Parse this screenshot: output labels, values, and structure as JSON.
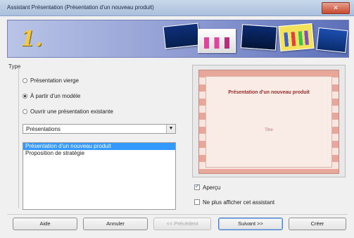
{
  "window": {
    "title": "Assistant Présentation (Présentation d'un nouveau produit)",
    "close_icon": "close-icon"
  },
  "banner": {
    "step_number": "1."
  },
  "type_section": {
    "label": "Type",
    "options": [
      {
        "label": "Présentation vierge",
        "checked": false
      },
      {
        "label": "À partir d'un modèle",
        "checked": true
      },
      {
        "label": "Ouvrir une présentation existante",
        "checked": false
      }
    ]
  },
  "template_category": {
    "selected": "Présentations",
    "arrow_icon": "chevron-down-icon"
  },
  "template_list": {
    "items": [
      {
        "label": "Présentation d'un nouveau produit",
        "selected": true
      },
      {
        "label": "Proposition de stratégie",
        "selected": false
      }
    ]
  },
  "preview": {
    "slide_title": "Présentation d'un nouveau produit",
    "slide_subtitle": "Titre"
  },
  "options": {
    "preview_label": "Aperçu",
    "preview_checked": true,
    "no_show_label": "Ne plus afficher cet assistant",
    "no_show_checked": false
  },
  "buttons": {
    "help": "Aide",
    "cancel": "Annuler",
    "previous": "<< Précédent",
    "next": "Suivant >>",
    "create": "Créer"
  },
  "colors": {
    "title_bar": "#a9bfdc",
    "banner_accent": "#f2c84b",
    "list_selection": "#3399ff",
    "slide_title": "#9b2c2c"
  }
}
